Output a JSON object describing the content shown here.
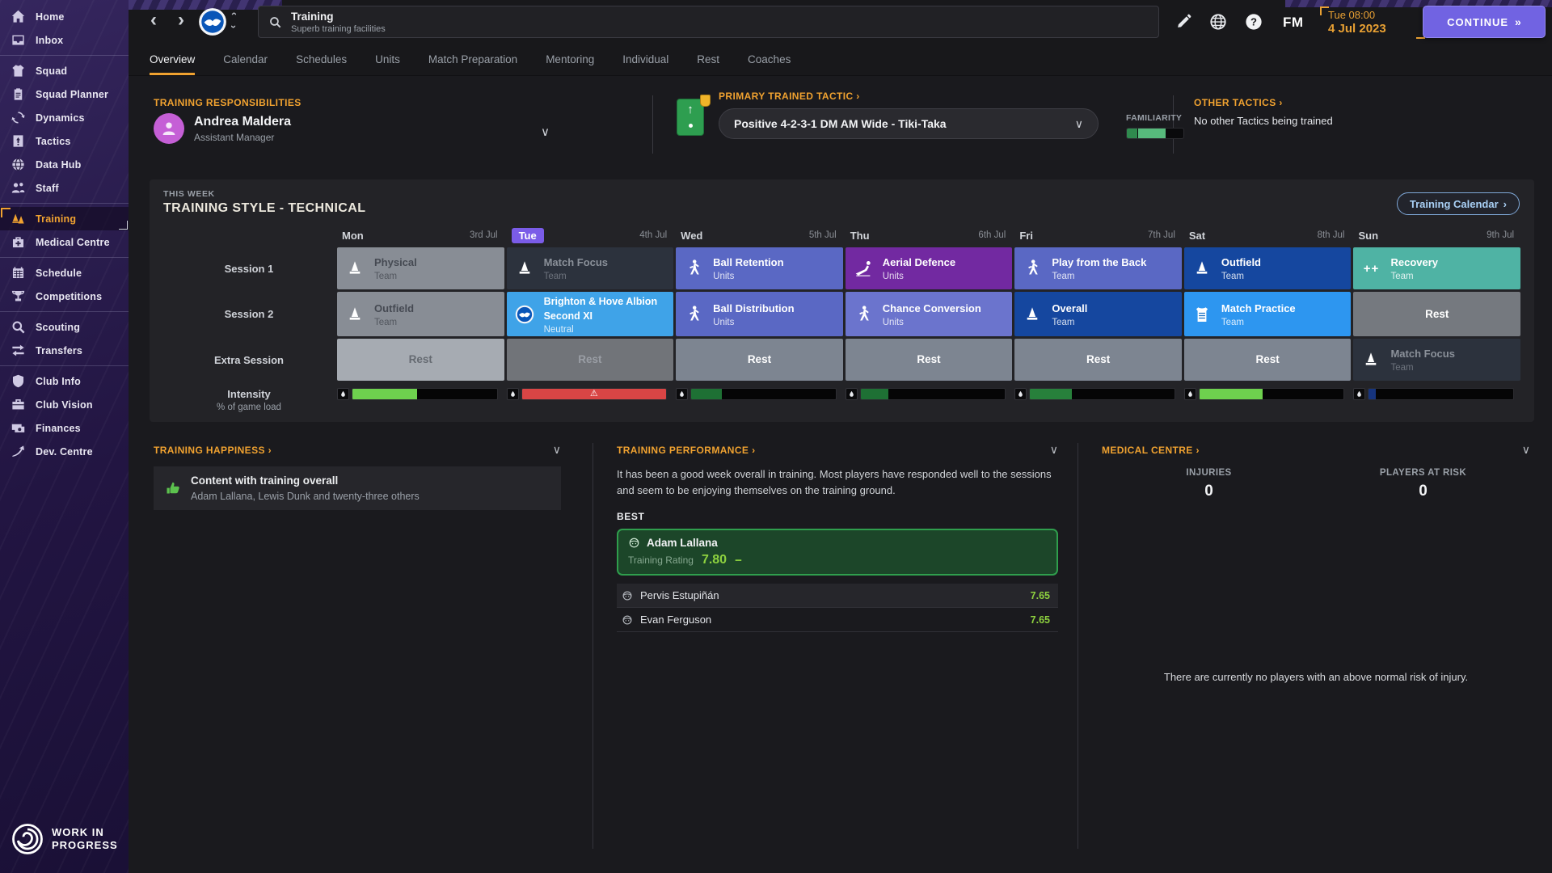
{
  "colors": {
    "accent_orange": "#f0a230",
    "continue_purple": "#7163e2",
    "current_day_purple": "#7a5ce8",
    "rating_green": "#8ed23f",
    "best_card_border": "#2f9e4d"
  },
  "sidebar": {
    "items": [
      {
        "label": "Home",
        "icon": "home-icon"
      },
      {
        "label": "Inbox",
        "icon": "inbox-icon",
        "divider_after": true
      },
      {
        "label": "Squad",
        "icon": "shirt-icon"
      },
      {
        "label": "Squad Planner",
        "icon": "clipboard-icon"
      },
      {
        "label": "Dynamics",
        "icon": "dynamics-icon"
      },
      {
        "label": "Tactics",
        "icon": "tactics-icon"
      },
      {
        "label": "Data Hub",
        "icon": "datahub-icon"
      },
      {
        "label": "Staff",
        "icon": "staff-icon",
        "divider_after": true
      },
      {
        "label": "Training",
        "icon": "training-icon",
        "active": true
      },
      {
        "label": "Medical Centre",
        "icon": "medical-icon",
        "divider_after": true
      },
      {
        "label": "Schedule",
        "icon": "calendar-icon"
      },
      {
        "label": "Competitions",
        "icon": "trophy-icon",
        "divider_after": true
      },
      {
        "label": "Scouting",
        "icon": "scout-icon"
      },
      {
        "label": "Transfers",
        "icon": "transfers-icon",
        "divider_after": true
      },
      {
        "label": "Club Info",
        "icon": "shield-icon"
      },
      {
        "label": "Club Vision",
        "icon": "briefcase-icon"
      },
      {
        "label": "Finances",
        "icon": "finances-icon"
      },
      {
        "label": "Dev. Centre",
        "icon": "devcentre-icon"
      }
    ],
    "footer": "WORK IN\nPROGRESS"
  },
  "header": {
    "search": {
      "title": "Training",
      "subtitle": "Superb training facilities"
    },
    "clock": {
      "time": "Tue 08:00",
      "date": "4 Jul 2023"
    },
    "continue_label": "CONTINUE",
    "continue_arrows": "»",
    "fm_label": "FM"
  },
  "tabs": {
    "items": [
      "Overview",
      "Calendar",
      "Schedules",
      "Units",
      "Match Preparation",
      "Mentoring",
      "Individual",
      "Rest",
      "Coaches"
    ],
    "active": "Overview"
  },
  "info_bar": {
    "responsibilities": {
      "heading": "TRAINING RESPONSIBILITIES",
      "name": "Andrea Maldera",
      "role": "Assistant Manager"
    },
    "tactic": {
      "heading": "PRIMARY TRAINED TACTIC ›",
      "value": "Positive 4-2-3-1 DM AM Wide - Tiki-Taka",
      "familiarity_label": "FAMILIARITY",
      "familiarity_pct": 48
    },
    "other_tactics": {
      "heading": "OTHER TACTICS ›",
      "value": "No other Tactics being trained"
    }
  },
  "week": {
    "eyebrow": "THIS WEEK",
    "title": "TRAINING STYLE - TECHNICAL",
    "calendar_button": "Training Calendar",
    "row_labels": {
      "session1": "Session 1",
      "session2": "Session 2",
      "extra": "Extra Session",
      "intensity": "Intensity",
      "intensity_sub": "% of game load"
    },
    "days": [
      {
        "name": "Mon",
        "date": "3rd Jul"
      },
      {
        "name": "Tue",
        "date": "4th Jul",
        "current": true
      },
      {
        "name": "Wed",
        "date": "5th Jul"
      },
      {
        "name": "Thu",
        "date": "6th Jul"
      },
      {
        "name": "Fri",
        "date": "7th Jul"
      },
      {
        "name": "Sat",
        "date": "8th Jul"
      },
      {
        "name": "Sun",
        "date": "9th Jul"
      }
    ],
    "session1": [
      {
        "title": "Physical",
        "subtitle": "Team",
        "icon": "cone-icon",
        "bg": "#888d95",
        "style": "dim"
      },
      {
        "title": "Match Focus",
        "subtitle": "Team",
        "icon": "cone-icon",
        "bg": "#2c323d",
        "style": "dimdark"
      },
      {
        "title": "Ball Retention",
        "subtitle": "Units",
        "icon": "drill-icon",
        "bg": "#5a68c4"
      },
      {
        "title": "Aerial Defence",
        "subtitle": "Units",
        "icon": "tackle-icon",
        "bg": "#7229a1"
      },
      {
        "title": "Play from the Back",
        "subtitle": "Team",
        "icon": "drill-icon",
        "bg": "#5a68c4"
      },
      {
        "title": "Outfield",
        "subtitle": "Team",
        "icon": "cone-icon",
        "bg": "#15479f"
      },
      {
        "title": "Recovery",
        "subtitle": "Team",
        "icon": "recovery-icon",
        "bg": "#4fb3a4"
      }
    ],
    "session2": [
      {
        "title": "Outfield",
        "subtitle": "Team",
        "icon": "cone-icon",
        "bg": "#888d95",
        "style": "dim"
      },
      {
        "title": "Brighton & Hove Albion Second XI",
        "subtitle": "Neutral",
        "icon": "club-badge-icon",
        "bg": "#3fa3e8",
        "match": true
      },
      {
        "title": "Ball Distribution",
        "subtitle": "Units",
        "icon": "drill-icon",
        "bg": "#5a68c4"
      },
      {
        "title": "Chance Conversion",
        "subtitle": "Units",
        "icon": "drill-icon",
        "bg": "#6b74cd"
      },
      {
        "title": "Overall",
        "subtitle": "Team",
        "icon": "cone-icon",
        "bg": "#15479f"
      },
      {
        "title": "Match Practice",
        "subtitle": "Team",
        "icon": "bib-icon",
        "bg": "#2d96f0"
      },
      {
        "title": "Rest",
        "rest": true,
        "bg": "#75797f"
      }
    ],
    "extra": [
      {
        "title": "Rest",
        "rest": true,
        "bg": "#a6abb2",
        "style": "dim"
      },
      {
        "title": "Rest",
        "rest": true,
        "bg": "#717479",
        "style": "dimdark"
      },
      {
        "title": "Rest",
        "rest": true,
        "bg": "#7d8591"
      },
      {
        "title": "Rest",
        "rest": true,
        "bg": "#7d8591"
      },
      {
        "title": "Rest",
        "rest": true,
        "bg": "#7d8591"
      },
      {
        "title": "Rest",
        "rest": true,
        "bg": "#7d8591"
      },
      {
        "title": "Match Focus",
        "subtitle": "Team",
        "icon": "cone-icon",
        "bg": "#2c323d",
        "style": "dimdark"
      }
    ],
    "intensity": [
      {
        "pct": 45,
        "color": "#6ed14e"
      },
      {
        "pct": 100,
        "color": "#d94545",
        "warning": "⚠"
      },
      {
        "pct": 21,
        "color": "#1e7034"
      },
      {
        "pct": 19,
        "color": "#1e7034"
      },
      {
        "pct": 29,
        "color": "#27803b"
      },
      {
        "pct": 44,
        "color": "#6ed14e"
      },
      {
        "pct": 5,
        "color": "#16347e"
      }
    ]
  },
  "happiness": {
    "heading": "TRAINING HAPPINESS ›",
    "item": {
      "title": "Content with training overall",
      "subtitle": "Adam Lallana, Lewis Dunk and twenty-three others",
      "icon": "thumbs-up-icon"
    }
  },
  "performance": {
    "heading": "TRAINING PERFORMANCE ›",
    "summary": "It has been a good week overall in training. Most players have responded well to the sessions and seem to be enjoying themselves on the training ground.",
    "best_label": "BEST",
    "best": {
      "name": "Adam Lallana",
      "rating_label": "Training Rating",
      "rating": "7.80",
      "trend": "−"
    },
    "players": [
      {
        "name": "Pervis Estupiñán",
        "rating": "7.65"
      },
      {
        "name": "Evan Ferguson",
        "rating": "7.65"
      }
    ]
  },
  "medical": {
    "heading": "MEDICAL CENTRE ›",
    "stats": [
      {
        "label": "INJURIES",
        "value": "0"
      },
      {
        "label": "PLAYERS AT RISK",
        "value": "0"
      }
    ],
    "note": "There are currently no players with an above normal risk of injury."
  }
}
